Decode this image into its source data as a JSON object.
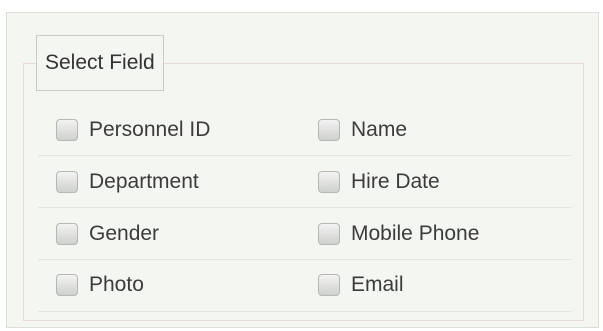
{
  "group_title": "Select Field",
  "fields": [
    {
      "label": "Personnel ID",
      "checked": false
    },
    {
      "label": "Name",
      "checked": false
    },
    {
      "label": "Department",
      "checked": false
    },
    {
      "label": "Hire Date",
      "checked": false
    },
    {
      "label": "Gender",
      "checked": false
    },
    {
      "label": "Mobile Phone",
      "checked": false
    },
    {
      "label": "Photo",
      "checked": false
    },
    {
      "label": "Email",
      "checked": false
    }
  ]
}
